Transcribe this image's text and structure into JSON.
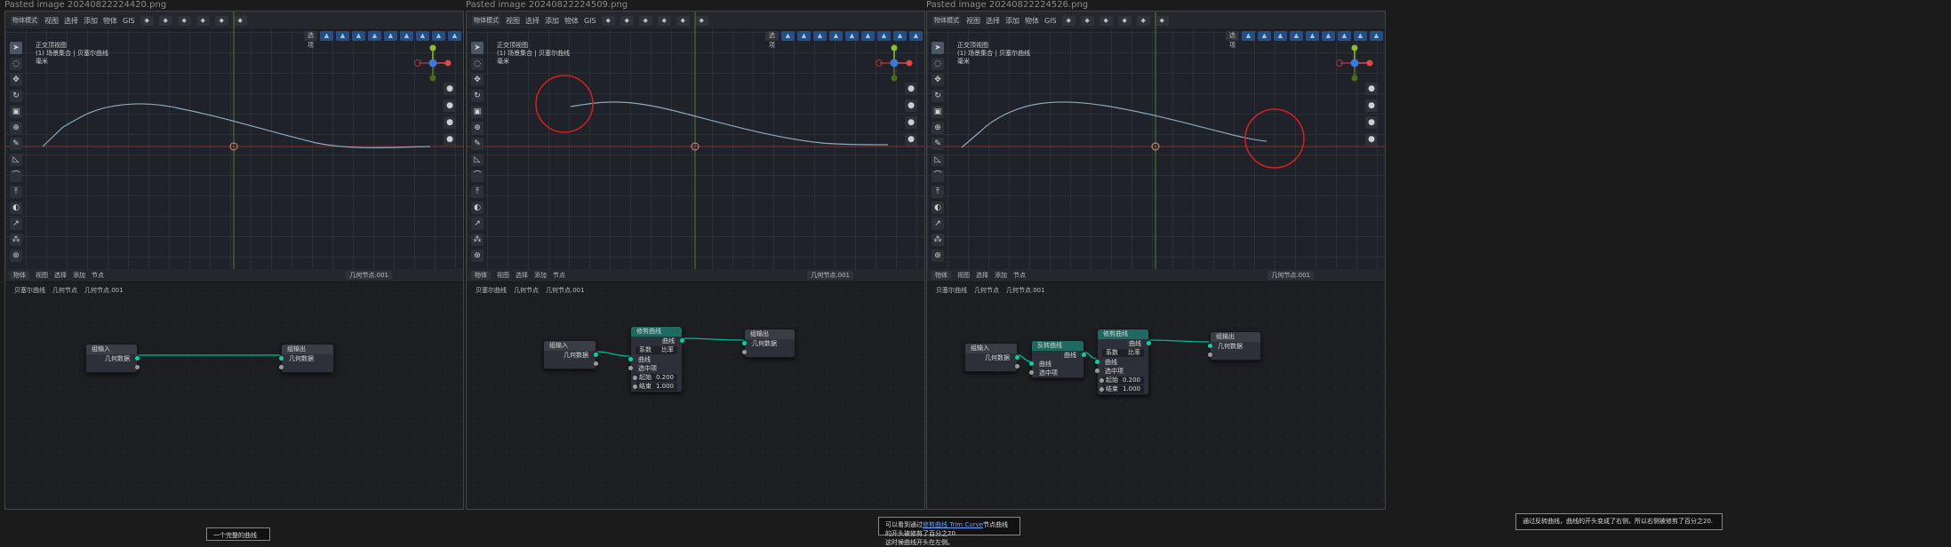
{
  "panels": [
    {
      "paste_title": "Pasted image 20240822224420.png",
      "mode": "物体模式",
      "menus": [
        "视图",
        "选择",
        "添加",
        "物体",
        "GIS"
      ],
      "view_options": "选项",
      "info": [
        "正交顶视图",
        "(1) 场景集合 | 贝塞尔曲线",
        "毫米"
      ],
      "ne_editor": "物体",
      "ne_menus": [
        "视图",
        "选择",
        "添加",
        "节点"
      ],
      "ne_group": "几何节点.001",
      "breadcrumb": [
        "贝塞尔曲线",
        "几何节点",
        "几何节点.001"
      ],
      "nodes": [
        {
          "title": "组输入",
          "geo": false,
          "rows": [
            {
              "t": "几何数据",
              "align": "r",
              "sock": "teal",
              "side": "rgt"
            },
            {
              "t": "",
              "align": "l",
              "sock": "grey",
              "side": "rgt"
            }
          ]
        },
        {
          "title": "组输出",
          "geo": false,
          "rows": [
            {
              "t": "几何数据",
              "align": "l",
              "sock": "teal",
              "side": "lft"
            },
            {
              "t": "",
              "align": "l",
              "sock": "grey",
              "side": "lft"
            }
          ]
        }
      ],
      "caption": {
        "pre": "一个完整的曲线",
        "link": "",
        "post": "",
        "line2": ""
      }
    },
    {
      "paste_title": "Pasted image 20240822224509.png",
      "mode": "物体模式",
      "menus": [
        "视图",
        "选择",
        "添加",
        "物体",
        "GIS"
      ],
      "view_options": "选项",
      "info": [
        "正交顶视图",
        "(1) 场景集合 | 贝塞尔曲线",
        "毫米"
      ],
      "ne_editor": "物体",
      "ne_menus": [
        "视图",
        "选择",
        "添加",
        "节点"
      ],
      "ne_group": "几何节点.001",
      "breadcrumb": [
        "贝塞尔曲线",
        "几何节点",
        "几何节点.001"
      ],
      "nodes": [
        {
          "title": "组输入",
          "geo": false,
          "rows": [
            {
              "t": "几何数据",
              "align": "r",
              "sock": "teal",
              "side": "rgt"
            },
            {
              "t": "",
              "align": "l",
              "sock": "grey",
              "side": "rgt"
            }
          ]
        },
        {
          "title": "修剪曲线",
          "geo": true,
          "rows": [
            {
              "t": "曲线",
              "align": "r",
              "sock": "teal",
              "side": "rgt"
            },
            {
              "t": "系数",
              "align": "l",
              "field": "比率"
            },
            {
              "t": "曲线",
              "align": "l",
              "sock": "teal",
              "side": "lft"
            },
            {
              "t": "选中项",
              "align": "l",
              "sock": "grey",
              "side": "lft"
            },
            {
              "t": "起始",
              "align": "l",
              "field": "0.200",
              "sock": "grey",
              "side": "lft"
            },
            {
              "t": "结束",
              "align": "l",
              "field": "1.000",
              "sock": "grey",
              "side": "lft"
            }
          ]
        },
        {
          "title": "组输出",
          "geo": false,
          "rows": [
            {
              "t": "几何数据",
              "align": "l",
              "sock": "teal",
              "side": "lft"
            },
            {
              "t": "",
              "align": "l",
              "sock": "grey",
              "side": "lft"
            }
          ]
        }
      ],
      "caption": {
        "pre": "可以看到通过",
        "link": "修剪曲线 Trim Curve",
        "post": "节点曲线的开头被修剪了百分之20.",
        "line2": "这时候曲线开头在左侧。"
      }
    },
    {
      "paste_title": "Pasted image 20240822224526.png",
      "mode": "物体模式",
      "menus": [
        "视图",
        "选择",
        "添加",
        "物体",
        "GIS"
      ],
      "view_options": "选项",
      "info": [
        "正交顶视图",
        "(1) 场景集合 | 贝塞尔曲线",
        "毫米"
      ],
      "ne_editor": "物体",
      "ne_menus": [
        "视图",
        "选择",
        "添加",
        "节点"
      ],
      "ne_group": "几何节点.001",
      "breadcrumb": [
        "贝塞尔曲线",
        "几何节点",
        "几何节点.001"
      ],
      "nodes": [
        {
          "title": "组输入",
          "geo": false,
          "rows": [
            {
              "t": "几何数据",
              "align": "r",
              "sock": "teal",
              "side": "rgt"
            },
            {
              "t": "",
              "align": "l",
              "sock": "grey",
              "side": "rgt"
            }
          ]
        },
        {
          "title": "反转曲线",
          "geo": true,
          "rows": [
            {
              "t": "曲线",
              "align": "r",
              "sock": "teal",
              "side": "rgt"
            },
            {
              "t": "曲线",
              "align": "l",
              "sock": "teal",
              "side": "lft"
            },
            {
              "t": "选中项",
              "align": "l",
              "sock": "grey",
              "side": "lft"
            }
          ]
        },
        {
          "title": "修剪曲线",
          "geo": true,
          "rows": [
            {
              "t": "曲线",
              "align": "r",
              "sock": "teal",
              "side": "rgt"
            },
            {
              "t": "系数",
              "align": "l",
              "field": "比率"
            },
            {
              "t": "曲线",
              "align": "l",
              "sock": "teal",
              "side": "lft"
            },
            {
              "t": "选中项",
              "align": "l",
              "sock": "grey",
              "side": "lft"
            },
            {
              "t": "起始",
              "align": "l",
              "field": "0.200",
              "sock": "grey",
              "side": "lft"
            },
            {
              "t": "结束",
              "align": "l",
              "field": "1.000",
              "sock": "grey",
              "side": "lft"
            }
          ]
        },
        {
          "title": "组输出",
          "geo": false,
          "rows": [
            {
              "t": "几何数据",
              "align": "l",
              "sock": "teal",
              "side": "lft"
            },
            {
              "t": "",
              "align": "l",
              "sock": "grey",
              "side": "lft"
            }
          ]
        }
      ],
      "caption": {
        "pre": "通过反转曲线，曲线的开头变成了右侧，所以右侧被修剪了百分之20.",
        "link": "",
        "post": "",
        "line2": ""
      }
    }
  ],
  "colors": {
    "x_axis": "#8a2b2b",
    "y_axis": "#5a7a2b",
    "curve": "#8aa9c0",
    "highlight": "#d62020",
    "link_teal": "#00b890"
  },
  "icons": {
    "tools": [
      "cursor-icon",
      "select-circle-icon",
      "move-icon",
      "rotate-icon",
      "scale-icon",
      "transform-icon",
      "annotate-icon",
      "measure-icon",
      "curve-draw-icon",
      "extrude-icon",
      "radius-icon",
      "tilt-icon",
      "randomize-icon",
      "add-bezier-icon"
    ]
  }
}
